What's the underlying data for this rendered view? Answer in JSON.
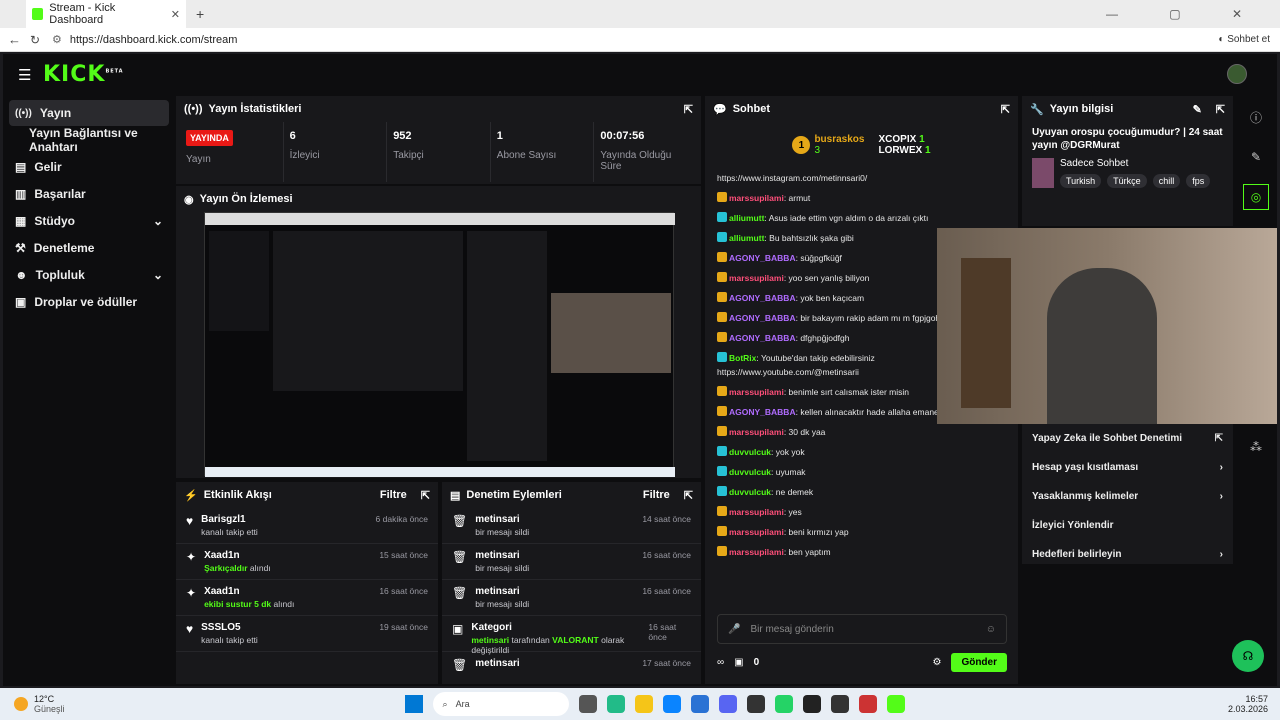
{
  "browser": {
    "tab_title": "Stream - Kick Dashboard",
    "url": "https://dashboard.kick.com/stream",
    "sohbet_label": "Sohbet et"
  },
  "brand": {
    "logo": "KICK",
    "beta": "BETA",
    "accent": "#53fc18"
  },
  "sidebar": {
    "items": [
      {
        "label": "Yayın",
        "icon": "broadcast-icon"
      },
      {
        "label": "Yayın Bağlantısı ve Anahtarı",
        "icon": ""
      },
      {
        "label": "Gelir",
        "icon": "bars-icon"
      },
      {
        "label": "Başarılar",
        "icon": "chart-icon"
      },
      {
        "label": "Stüdyo",
        "icon": "studio-icon"
      },
      {
        "label": "Denetleme",
        "icon": "hammer-icon"
      },
      {
        "label": "Topluluk",
        "icon": "people-icon"
      },
      {
        "label": "Droplar ve ödüller",
        "icon": "gift-icon"
      }
    ]
  },
  "stats": {
    "title": "Yayın İstatistikleri",
    "live_badge": "YAYINDA",
    "items": [
      {
        "value": "",
        "label": "Yayın"
      },
      {
        "value": "6",
        "label": "İzleyici"
      },
      {
        "value": "952",
        "label": "Takipçi"
      },
      {
        "value": "1",
        "label": "Abone Sayısı"
      },
      {
        "value": "00:07:56",
        "label": "Yayında Olduğu Süre"
      }
    ]
  },
  "preview": {
    "title": "Yayın Ön İzlemesi"
  },
  "activity": {
    "title": "Etkinlik Akışı",
    "filter": "Filtre",
    "items": [
      {
        "name": "Barisgzl1",
        "sub_pre": "kanalı takip etti",
        "sub_green": "",
        "sub_post": "",
        "time": "6 dakika önce",
        "icon": "heart-icon"
      },
      {
        "name": "Xaad1n",
        "sub_pre": "",
        "sub_green": "Şarkıçaldır",
        "sub_post": " alındı",
        "time": "15 saat önce",
        "icon": "reward-icon"
      },
      {
        "name": "Xaad1n",
        "sub_pre": "",
        "sub_green": "ekibi sustur 5 dk",
        "sub_post": " alındı",
        "time": "16 saat önce",
        "icon": "reward-icon"
      },
      {
        "name": "SSSLO5",
        "sub_pre": "kanalı takip etti",
        "sub_green": "",
        "sub_post": "",
        "time": "19 saat önce",
        "icon": "heart-icon"
      }
    ]
  },
  "moderation": {
    "title": "Denetim Eylemleri",
    "filter": "Filtre",
    "items": [
      {
        "name": "metinsari",
        "sub_pre": "bir mesajı sildi",
        "sub_green": "",
        "sub_mid": "",
        "sub_green2": "",
        "sub_post": "",
        "time": "14 saat önce"
      },
      {
        "name": "metinsari",
        "sub_pre": "bir mesajı sildi",
        "sub_green": "",
        "sub_mid": "",
        "sub_green2": "",
        "sub_post": "",
        "time": "16 saat önce"
      },
      {
        "name": "metinsari",
        "sub_pre": "bir mesajı sildi",
        "sub_green": "",
        "sub_mid": "",
        "sub_green2": "",
        "sub_post": "",
        "time": "16 saat önce"
      },
      {
        "name": "Kategori",
        "sub_pre": "",
        "sub_green": "metinsari",
        "sub_mid": " tarafından ",
        "sub_green2": "VALORANT",
        "sub_post": " olarak değiştirildi",
        "time": "16 saat önce"
      },
      {
        "name": "metinsari",
        "sub_pre": "",
        "sub_green": "",
        "sub_mid": "",
        "sub_green2": "",
        "sub_post": "",
        "time": "17 saat önce"
      }
    ]
  },
  "chat": {
    "title": "Sohbet",
    "leaders": [
      {
        "rank": "1",
        "name": "busraskos",
        "count": "3"
      },
      {
        "rank": "",
        "name": "XCOPIX",
        "count": "1"
      },
      {
        "rank": "",
        "name": "LORWEX",
        "count": "1"
      }
    ],
    "messages": [
      {
        "user": "",
        "color": "",
        "text": "https://www.instagram.com/metinnsari0/"
      },
      {
        "user": "marssupilami",
        "color": "pink",
        "text": "armut"
      },
      {
        "user": "alliumutt",
        "color": "green",
        "text": "Asus iade ettim vgn aldım o da arızalı çıktı"
      },
      {
        "user": "alliumutt",
        "color": "green",
        "text": "Bu bahtsızlık şaka gibi"
      },
      {
        "user": "AGONY_BABBA",
        "color": "purple",
        "text": "süğpgfküğf"
      },
      {
        "user": "marssupilami",
        "color": "pink",
        "text": "yoo sen yanlış biliyon"
      },
      {
        "user": "AGONY_BABBA",
        "color": "purple",
        "text": "yok ben kaçıcam"
      },
      {
        "user": "AGONY_BABBA",
        "color": "purple",
        "text": "bir bakayım rakip adam mı m fgpjgohdfg"
      },
      {
        "user": "AGONY_BABBA",
        "color": "purple",
        "text": "dfghpğjodfgh"
      },
      {
        "user": "BotRix",
        "color": "green",
        "text": "Youtube'dan takip edebilirsiniz https://www.youtube.com/@metinsarii"
      },
      {
        "user": "marssupilami",
        "color": "pink",
        "text": "benimle sırt calısmak ister misin"
      },
      {
        "user": "AGONY_BABBA",
        "color": "purple",
        "text": "kellen alınacaktır hade allaha emanet"
      },
      {
        "user": "marssupilami",
        "color": "pink",
        "text": "30 dk yaa"
      },
      {
        "user": "duvvulcuk",
        "color": "green",
        "text": "yok yok"
      },
      {
        "user": "duvvulcuk",
        "color": "green",
        "text": "uyumak"
      },
      {
        "user": "duvvulcuk",
        "color": "green",
        "text": "ne demek"
      },
      {
        "user": "marssupilami",
        "color": "pink",
        "text": "yes"
      },
      {
        "user": "marssupilami",
        "color": "pink",
        "text": "beni kırmızı yap"
      },
      {
        "user": "marssupilami",
        "color": "pink",
        "text": "ben yaptım"
      }
    ],
    "input_placeholder": "Bir mesaj gönderin",
    "points": "0",
    "send_label": "Gönder"
  },
  "info": {
    "title": "Yayın bilgisi",
    "stream_title": "Uyuyan orospu çocuğumudur? | 24 saat yayın @DGRMurat",
    "category": "Sadece Sohbet",
    "tags": [
      "Turkish",
      "Türkçe",
      "chill",
      "fps"
    ]
  },
  "ai_menu": {
    "items": [
      {
        "label": "Yapay Zeka ile Sohbet Denetimi",
        "arrow": "external"
      },
      {
        "label": "Hesap yaşı kısıtlaması",
        "arrow": "chevron"
      },
      {
        "label": "Yasaklanmış kelimeler",
        "arrow": "chevron"
      },
      {
        "label": "İzleyici Yönlendir",
        "arrow": ""
      },
      {
        "label": "Hedefleri belirleyin",
        "arrow": "chevron"
      }
    ]
  },
  "taskbar": {
    "weather_temp": "12°C",
    "weather_desc": "Güneşli",
    "search": "Ara",
    "time": "16:57",
    "date": "2.03.2026"
  }
}
